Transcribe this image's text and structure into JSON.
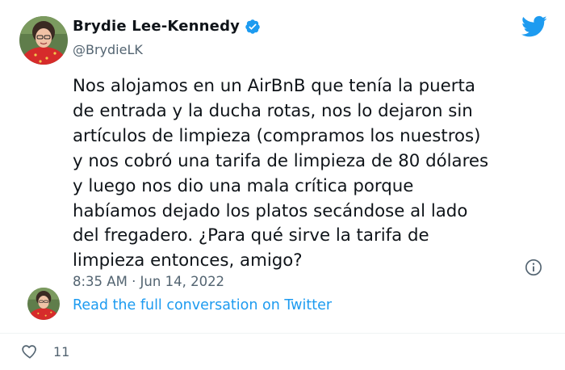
{
  "author": {
    "name": "Brydie Lee-Kennedy",
    "handle": "@BrydieLK"
  },
  "tweet": {
    "text": "Nos alojamos en un AirBnB que tenía la puerta\nde entrada y la ducha rotas, nos lo dejaron sin\nartículos de limpieza (compramos los nuestros)\ny nos cobró una tarifa de limpieza de 80 dólares\ny luego nos dio una mala crítica porque\nhabíamos dejado los platos secándose al lado\ndel fregadero. ¿Para qué sirve la tarifa de\nlimpieza entonces, amigo?",
    "timestamp": "8:35 AM · Jun 14, 2022"
  },
  "conversation_link": "Read the full conversation on Twitter",
  "actions": {
    "like_count": "11"
  },
  "icons": {
    "brand": "twitter-bird-icon",
    "verified": "verified-badge-icon",
    "info": "info-icon",
    "like": "heart-icon"
  },
  "colors": {
    "accent": "#1d9bf0",
    "text": "#0f1419",
    "secondary": "#536471",
    "avatar_shirt": "#d62b2b"
  }
}
